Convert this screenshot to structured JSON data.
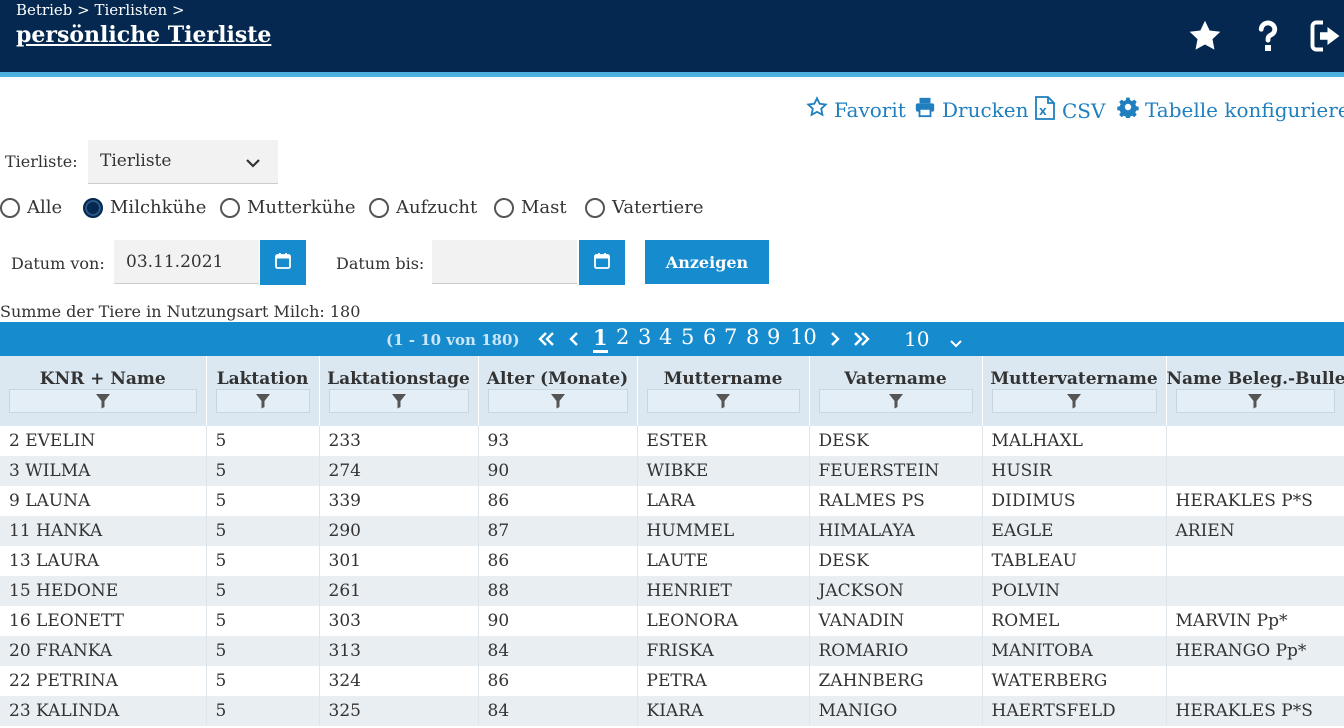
{
  "header": {
    "breadcrumb": "Betrieb > Tierlisten >",
    "title": "persönliche Tierliste",
    "icons": [
      "star-icon",
      "question-icon",
      "logout-icon"
    ]
  },
  "actions": {
    "favorite": "Favorit",
    "print": "Drucken",
    "csv": "CSV",
    "configure": "Tabelle konfigurieren"
  },
  "filter": {
    "tierliste_label": "Tierliste:",
    "tierliste_value": "Tierliste",
    "radios": [
      {
        "label": "Alle",
        "checked": false
      },
      {
        "label": "Milchkühe",
        "checked": true
      },
      {
        "label": "Mutterkühe",
        "checked": false
      },
      {
        "label": "Aufzucht",
        "checked": false
      },
      {
        "label": "Mast",
        "checked": false
      },
      {
        "label": "Vatertiere",
        "checked": false
      }
    ],
    "date_from_label": "Datum von:",
    "date_from_value": "03.11.2021",
    "date_to_label": "Datum bis:",
    "date_to_value": "",
    "show_button": "Anzeigen"
  },
  "summary": "Summe der Tiere in Nutzungsart Milch: 180",
  "pager": {
    "range": "(1 - 10 von 180)",
    "pages": [
      "1",
      "2",
      "3",
      "4",
      "5",
      "6",
      "7",
      "8",
      "9",
      "10"
    ],
    "current": "1",
    "page_size": "10"
  },
  "table": {
    "columns": [
      "KNR + Name",
      "Laktation",
      "Laktationstage",
      "Alter (Monate)",
      "Muttername",
      "Vatername",
      "Muttervatername",
      "Name Beleg.-Bulle"
    ],
    "rows": [
      [
        "2 EVELIN",
        "5",
        "233",
        "93",
        "ESTER",
        "DESK",
        "MALHAXL",
        ""
      ],
      [
        "3 WILMA",
        "5",
        "274",
        "90",
        "WIBKE",
        "FEUERSTEIN",
        "HUSIR",
        ""
      ],
      [
        "9 LAUNA",
        "5",
        "339",
        "86",
        "LARA",
        "RALMES PS",
        "DIDIMUS",
        "HERAKLES P*S"
      ],
      [
        "11 HANKA",
        "5",
        "290",
        "87",
        "HUMMEL",
        "HIMALAYA",
        "EAGLE",
        "ARIEN"
      ],
      [
        "13 LAURA",
        "5",
        "301",
        "86",
        "LAUTE",
        "DESK",
        "TABLEAU",
        ""
      ],
      [
        "15 HEDONE",
        "5",
        "261",
        "88",
        "HENRIET",
        "JACKSON",
        "POLVIN",
        ""
      ],
      [
        "16 LEONETT",
        "5",
        "303",
        "90",
        "LEONORA",
        "VANADIN",
        "ROMEL",
        "MARVIN Pp*"
      ],
      [
        "20 FRANKA",
        "5",
        "313",
        "84",
        "FRISKA",
        "ROMARIO",
        "MANITOBA",
        "HERANGO Pp*"
      ],
      [
        "22 PETRINA",
        "5",
        "324",
        "86",
        "PETRA",
        "ZAHNBERG",
        "WATERBERG",
        ""
      ],
      [
        "23 KALINDA",
        "5",
        "325",
        "84",
        "KIARA",
        "MANIGO",
        "HAERTSFELD",
        "HERAKLES P*S"
      ]
    ]
  },
  "colors": {
    "header_bg": "#04284f",
    "accent": "#168ccf",
    "link": "#1f7fbf"
  }
}
